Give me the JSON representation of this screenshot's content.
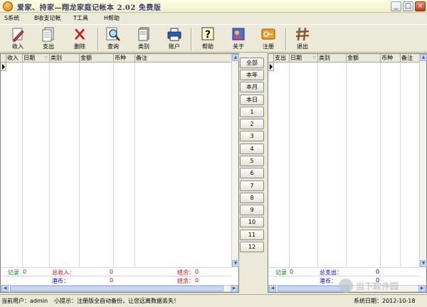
{
  "window": {
    "title": "爱家、持家—翔龙家庭记帐本 2.02 免费版",
    "controls": {
      "minimize": "_",
      "maximize": "□",
      "close": "×"
    }
  },
  "menu": [
    {
      "label": "S系统"
    },
    {
      "label": "B收支记帐"
    },
    {
      "label": "T工具"
    },
    {
      "label": "H帮助"
    }
  ],
  "toolbar": [
    {
      "label": "收入",
      "icon": "income-pencil-icon"
    },
    {
      "label": "支出",
      "icon": "expense-document-icon"
    },
    {
      "label": "删除",
      "icon": "delete-x-icon"
    },
    {
      "label": "查询",
      "icon": "query-magnifier-icon"
    },
    {
      "label": "类别",
      "icon": "category-book-icon"
    },
    {
      "label": "账户",
      "icon": "account-printer-icon"
    },
    {
      "label": "帮助",
      "icon": "help-question-icon"
    },
    {
      "label": "关于",
      "icon": "about-icon"
    },
    {
      "label": "注册",
      "icon": "register-key-icon"
    },
    {
      "label": "退出",
      "icon": "exit-fence-icon"
    }
  ],
  "income_grid": {
    "headers": [
      "收入",
      "日期",
      "类别",
      "金额",
      "币种",
      "备注"
    ],
    "footer": {
      "record_label": "记录",
      "record_count": "0",
      "total_label": "总收入：",
      "total_value": "0",
      "balance_label": "结余：",
      "balance_value": "0",
      "currency_label": "港币：",
      "currency_value": "0",
      "currency_balance_label": "结余：",
      "currency_balance_value": "0"
    }
  },
  "months": [
    "全部",
    "本年",
    "本月",
    "本日",
    "1",
    "2",
    "3",
    "4",
    "5",
    "6",
    "7",
    "8",
    "9",
    "10",
    "11",
    "12"
  ],
  "expense_grid": {
    "headers": [
      "支出",
      "日期",
      "类别",
      "金额",
      "币种",
      "备注"
    ],
    "footer": {
      "record_label": "记录",
      "record_count": "0",
      "total_label": "总支出：",
      "total_value": "0",
      "currency_label": "港币：",
      "currency_value": "0"
    }
  },
  "status": {
    "user": "当前用户：admin",
    "tip": "小提示：注册版全自动备份，让您远离数据丢失！",
    "date": "系统日期：2012-10-18"
  },
  "watermark": "当下软件园",
  "colors": {
    "footer_green": "#008000",
    "footer_red": "#e00000",
    "footer_blue": "#0000e0",
    "title_text": "#3a3a78"
  }
}
